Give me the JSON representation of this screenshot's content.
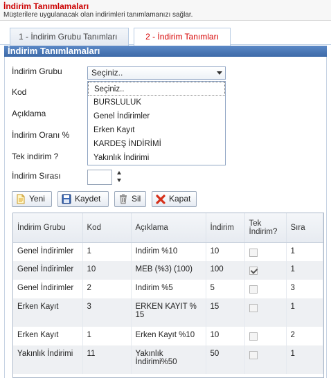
{
  "header": {
    "title": "İndirim Tanımlamaları",
    "subtitle": "Müşterilere uygulanacak olan indirimleri tanımlamanızı sağlar."
  },
  "tabs": [
    {
      "label": "1 - İndirim Grubu Tanımları",
      "active": false
    },
    {
      "label": "2 - İndirim Tanımları",
      "active": true
    }
  ],
  "panel": {
    "title": "İndirim Tanımlamaları"
  },
  "form": {
    "group_label": "İndirim Grubu",
    "code_label": "Kod",
    "desc_label": "Açıklama",
    "rate_label": "İndirim Oranı %",
    "single_label": "Tek indirim ?",
    "order_label": "İndirim Sırası",
    "group_selected": "Seçiniz..",
    "group_options": [
      "Seçiniz..",
      "BURSLULUK",
      "Genel İndirimler",
      "Erken Kayıt",
      "KARDEŞ İNDİRİMİ",
      "Yakınlık İndirimi"
    ]
  },
  "toolbar": {
    "new_label": "Yeni",
    "save_label": "Kaydet",
    "delete_label": "Sil",
    "close_label": "Kapat"
  },
  "grid": {
    "columns": [
      "İndirim Grubu",
      "Kod",
      "Açıklama",
      "İndirim",
      "Tek İndirim?",
      "Sıra"
    ],
    "rows": [
      {
        "group": "Genel İndirimler",
        "code": "1",
        "desc": "Indirim %10",
        "discount": "10",
        "single": false,
        "order": "1"
      },
      {
        "group": "Genel İndirimler",
        "code": "10",
        "desc": "MEB (%3) (100)",
        "discount": "100",
        "single": true,
        "order": "1"
      },
      {
        "group": "Genel İndirimler",
        "code": "2",
        "desc": "Indirim %5",
        "discount": "5",
        "single": false,
        "order": "3"
      },
      {
        "group": "Erken Kayıt",
        "code": "3",
        "desc": "ERKEN KAYIT % 15",
        "discount": "15",
        "single": false,
        "order": "1"
      },
      {
        "group": "Erken Kayıt",
        "code": "1",
        "desc": "Erken Kayıt %10",
        "discount": "10",
        "single": false,
        "order": "2"
      },
      {
        "group": "Yakınlık İndirimi",
        "code": "11",
        "desc": "Yakınlık İndirimi%50",
        "discount": "50",
        "single": false,
        "order": "1"
      }
    ]
  },
  "colors": {
    "title_red": "#cc0000",
    "panel_blue": "#3d6aa8",
    "tab_active_text": "#d60000"
  }
}
